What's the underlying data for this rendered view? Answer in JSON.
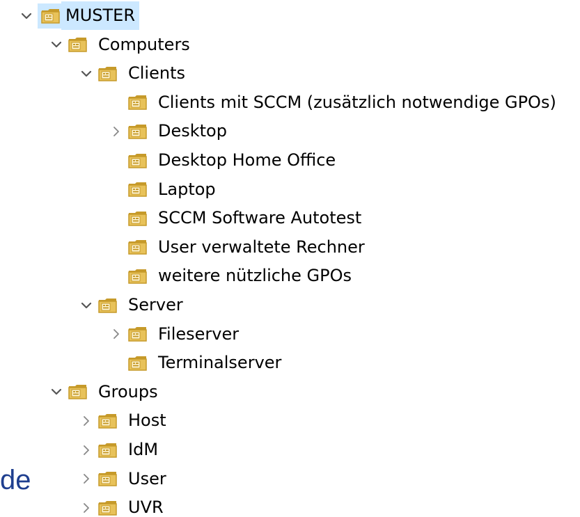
{
  "colors": {
    "selection": "#cce8ff",
    "folder_fill": "#e8c25a",
    "folder_dark": "#c69a2a",
    "chevron": "#555555",
    "side_text": "#1f3f8f"
  },
  "side_text": "de",
  "tree": [
    {
      "label": "MUSTER",
      "state": "expanded",
      "level": 0,
      "selected": true
    },
    {
      "label": "Computers",
      "state": "expanded",
      "level": 1
    },
    {
      "label": "Clients",
      "state": "expanded",
      "level": 2
    },
    {
      "label": "Clients mit SCCM (zusätzlich notwendige GPOs)",
      "state": "leaf",
      "level": 3
    },
    {
      "label": "Desktop",
      "state": "collapsed",
      "level": 3
    },
    {
      "label": "Desktop Home Office",
      "state": "leaf",
      "level": 3
    },
    {
      "label": "Laptop",
      "state": "leaf",
      "level": 3
    },
    {
      "label": "SCCM Software Autotest",
      "state": "leaf",
      "level": 3
    },
    {
      "label": "User verwaltete Rechner",
      "state": "leaf",
      "level": 3
    },
    {
      "label": "weitere nützliche GPOs",
      "state": "leaf",
      "level": 3
    },
    {
      "label": "Server",
      "state": "expanded",
      "level": 2
    },
    {
      "label": "Fileserver",
      "state": "collapsed",
      "level": 3
    },
    {
      "label": "Terminalserver",
      "state": "leaf",
      "level": 3
    },
    {
      "label": "Groups",
      "state": "expanded",
      "level": 1
    },
    {
      "label": "Host",
      "state": "collapsed",
      "level": 2
    },
    {
      "label": "IdM",
      "state": "collapsed",
      "level": 2
    },
    {
      "label": "User",
      "state": "collapsed",
      "level": 2
    },
    {
      "label": "UVR",
      "state": "collapsed",
      "level": 2
    }
  ]
}
